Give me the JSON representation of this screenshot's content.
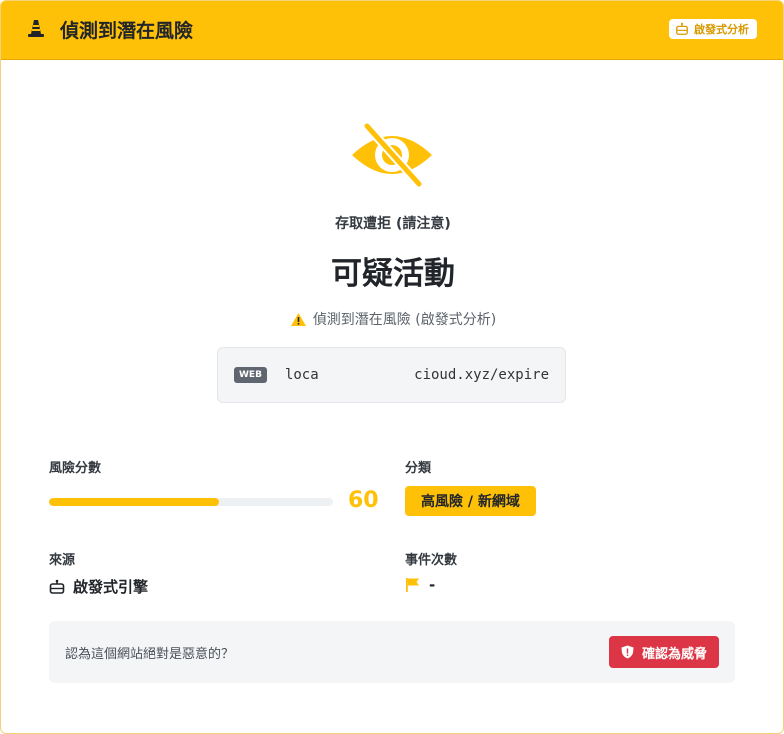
{
  "header": {
    "title": "偵測到潛在風險",
    "badge_label": "啟發式分析",
    "icon": "traffic-cone-icon"
  },
  "hero": {
    "icon": "eye-slash-icon",
    "subtitle": "存取遭拒 (請注意)",
    "title": "可疑活動",
    "warning": "偵測到潛在風險 (啟發式分析)"
  },
  "url": {
    "badge": "WEB",
    "start": "loca",
    "end": "cioud.xyz/expire"
  },
  "risk": {
    "label": "風險分數",
    "score": "60",
    "score_fraction": 0.6
  },
  "category": {
    "label": "分類",
    "value": "高風險 / 新網域"
  },
  "source": {
    "label": "來源",
    "value": "啟發式引擎",
    "icon": "robot-icon"
  },
  "events": {
    "label": "事件次數",
    "value": "-",
    "icon": "flag-icon"
  },
  "confirm": {
    "question": "認為這個網站絕對是惡意的？",
    "button_label": "確認為威脅",
    "button_icon": "shield-exclamation-icon"
  },
  "colors": {
    "accent": "#ffc107",
    "danger": "#dc3545"
  }
}
